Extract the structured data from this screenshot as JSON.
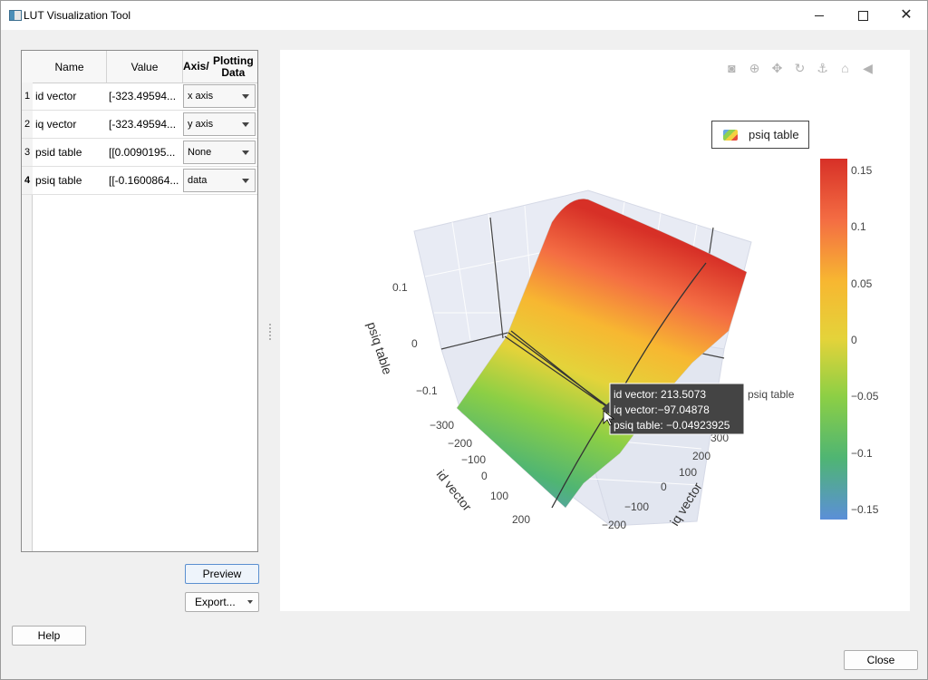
{
  "window": {
    "title": "LUT Visualization Tool",
    "minimize_glyph": "—",
    "maximize_glyph": "□",
    "close_glyph": "✕"
  },
  "table": {
    "headers": {
      "name": "Name",
      "value": "Value",
      "axis_line1": "Axis/",
      "axis_line2": "Plotting Data"
    },
    "rows": [
      {
        "num": "1",
        "name": "id vector",
        "value": "[-323.49594...",
        "role": "x axis"
      },
      {
        "num": "2",
        "name": "iq vector",
        "value": "[-323.49594...",
        "role": "y axis"
      },
      {
        "num": "3",
        "name": "psid table",
        "value": "[[0.0090195...",
        "role": "None"
      },
      {
        "num": "4",
        "name": "psiq table",
        "value": "[[-0.1600864...",
        "role": "data"
      }
    ]
  },
  "buttons": {
    "preview": "Preview",
    "export": "Export...",
    "help": "Help",
    "close": "Close"
  },
  "modebar": {
    "icons": [
      "camera-icon",
      "zoom-icon",
      "pan-icon",
      "orbit-rotation-icon",
      "turntable-rotation-icon",
      "home-icon",
      "toggle-hover-icon"
    ],
    "glyphs": [
      "◙",
      "⊕",
      "✥",
      "↻",
      "⚓",
      "⌂",
      "◀"
    ]
  },
  "legend": {
    "label": "psiq table"
  },
  "colorbar": {
    "ticks": [
      "0.15",
      "0.1",
      "0.05",
      "0",
      "−0.05",
      "−0.1",
      "−0.15"
    ],
    "colors": [
      "#d73027",
      "#f46d43",
      "#f7b731",
      "#e4d33a",
      "#8ccf45",
      "#4fb573",
      "#5b8fd8"
    ]
  },
  "chart_data": {
    "type": "surface",
    "series": [
      {
        "name": "psiq table"
      }
    ],
    "x_axis": {
      "label": "id vector",
      "ticks": [
        "−300",
        "−200",
        "−100",
        "0",
        "100",
        "200"
      ]
    },
    "y_axis": {
      "label": "iq vector",
      "ticks": [
        "−200",
        "−100",
        "0",
        "100",
        "200",
        "300"
      ]
    },
    "z_axis": {
      "label": "psiq table",
      "ticks": [
        "0.1",
        "0",
        "−0.1"
      ]
    },
    "color_range": [
      -0.16,
      0.16
    ],
    "hover": {
      "line1": "id vector: 213.5073",
      "line2": "iq vector:−97.04878",
      "line3": "psiq table: −0.04923925",
      "trace": "psiq table"
    }
  }
}
